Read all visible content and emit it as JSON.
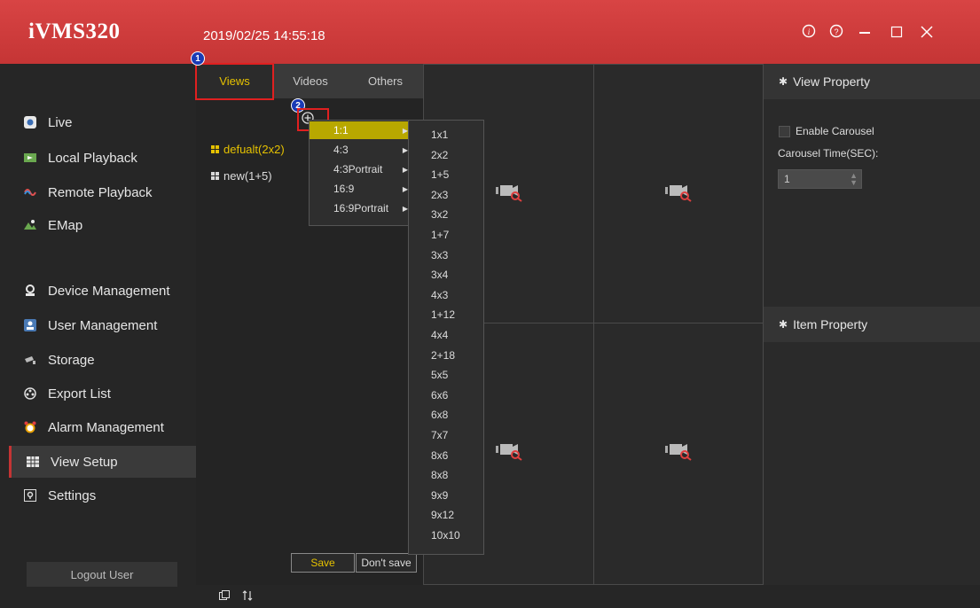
{
  "app": {
    "title": "iVMS320",
    "datetime": "2019/02/25 14:55:18"
  },
  "window_controls": {
    "info": "ⓘ",
    "help": "?",
    "minimize": "—",
    "maximize": "□",
    "close": "✕"
  },
  "sidebar": {
    "items": [
      {
        "label": "Live",
        "icon": "live-icon"
      },
      {
        "label": "Local Playback",
        "icon": "local-playback-icon"
      },
      {
        "label": "Remote Playback",
        "icon": "remote-playback-icon"
      },
      {
        "label": "EMap",
        "icon": "emap-icon"
      },
      {
        "label": "Device Management",
        "icon": "device-icon"
      },
      {
        "label": "User Management",
        "icon": "user-icon"
      },
      {
        "label": "Storage",
        "icon": "storage-icon"
      },
      {
        "label": "Export List",
        "icon": "export-icon"
      },
      {
        "label": "Alarm Management",
        "icon": "alarm-icon"
      },
      {
        "label": "View Setup",
        "icon": "view-setup-icon"
      },
      {
        "label": "Settings",
        "icon": "settings-icon"
      }
    ],
    "active": "View Setup",
    "logout_label": "Logout User"
  },
  "tabs": [
    {
      "label": "Views"
    },
    {
      "label": "Videos"
    },
    {
      "label": "Others"
    }
  ],
  "views": [
    {
      "label": "defualt(2x2)",
      "selected": true
    },
    {
      "label": "new(1+5)",
      "selected": false
    }
  ],
  "badges": {
    "one": "1",
    "two": "2"
  },
  "ratio_menu": [
    {
      "label": "1:1",
      "selected": true
    },
    {
      "label": "4:3",
      "selected": false
    },
    {
      "label": "4:3Portrait",
      "selected": false
    },
    {
      "label": "16:9",
      "selected": false
    },
    {
      "label": "16:9Portrait",
      "selected": false
    }
  ],
  "layout_menu": [
    "1x1",
    "2x2",
    "1+5",
    "2x3",
    "3x2",
    "1+7",
    "3x3",
    "3x4",
    "4x3",
    "1+12",
    "4x4",
    "2+18",
    "5x5",
    "6x6",
    "6x8",
    "7x7",
    "8x6",
    "8x8",
    "9x9",
    "9x12",
    "10x10"
  ],
  "buttons": {
    "save": "Save",
    "dont_save": "Don't save"
  },
  "view_property": {
    "title": "View Property",
    "enable_carousel": "Enable Carousel",
    "carousel_time_label": "Carousel Time(SEC):",
    "carousel_time_value": "1"
  },
  "item_property": {
    "title": "Item Property"
  },
  "colors": {
    "titlebar": "#d13e3e",
    "accent": "#e6c200",
    "menu_selected": "#b8a800"
  }
}
